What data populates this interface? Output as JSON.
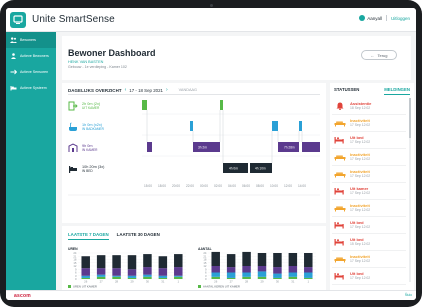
{
  "app": {
    "title": "Unite SmartSense"
  },
  "topbar": {
    "user": "Aanyall",
    "logout": "Uitloggen"
  },
  "sidebar": {
    "items": [
      {
        "label": "Bewoners",
        "icon": "users-icon"
      },
      {
        "label": "Actieve Bewoners",
        "icon": "person-icon"
      },
      {
        "label": "Actieve Sensoren",
        "icon": "sensor-icon"
      },
      {
        "label": "Actieve Systeem",
        "icon": "bed-icon"
      }
    ]
  },
  "header": {
    "title": "Bewoner Dashboard",
    "resident_name": "HENK VAN BASTEN",
    "resident_location": "Gebouw - 1e verdieping - Kamer 102",
    "back_label": "Terug"
  },
  "daily": {
    "title": "DAGELIJKS OVERZICHT",
    "date_range": "17 - 18 Sep 2021",
    "today_label": "VANDAAG",
    "activities": [
      {
        "duration": "2h 0m (2x)",
        "label": "UIT KAMER",
        "color": "#57b947",
        "icon": "door-exit-icon"
      },
      {
        "duration": "1h 0m (x2x)",
        "label": "IN BADKAMER",
        "color": "#2aa0d6",
        "icon": "bath-icon"
      },
      {
        "duration": "9h 0m",
        "label": "IN KAMER",
        "color": "#5b3a8e",
        "icon": "room-icon"
      },
      {
        "duration": "10h 20m (3x)",
        "label": "IN BED",
        "color": "#1f2a33",
        "icon": "bed-icon"
      }
    ],
    "bar_labels": {
      "kamer_1": "3h 2m",
      "kamer_2": "7h 28m",
      "bed_1": "4h 0m",
      "bed_2": "4h 10m"
    },
    "time_ticks": [
      "15:00",
      "18:00",
      "20:00",
      "22:00",
      "00:00",
      "02:00",
      "04:00",
      "06:00",
      "08:00",
      "10:00",
      "12:00",
      "14:00"
    ]
  },
  "weekly": {
    "tabs": [
      "LAATSTE 7 DAGEN",
      "LAATSTE 30 DAGEN"
    ],
    "chart_left": {
      "title": "UREN",
      "legend": "UREN UIT KAMER"
    },
    "chart_right": {
      "title": "AANTAL",
      "legend": "AANTAL KEREN UIT KAMER"
    }
  },
  "chart_data": [
    {
      "type": "bar",
      "title": "UREN",
      "categories": [
        "26",
        "27",
        "28",
        "29",
        "30",
        "31",
        "1"
      ],
      "series": [
        {
          "name": "UREN UIT KAMER",
          "values": [
            1,
            2,
            2,
            1,
            2,
            1,
            2
          ],
          "color": "#57b947"
        },
        {
          "values": [
            2,
            2,
            1,
            2,
            2,
            2,
            1
          ],
          "color": "#2aa0d6"
        },
        {
          "values": [
            7,
            6,
            7,
            6,
            7,
            7,
            8
          ],
          "color": "#5b3a8e"
        },
        {
          "values": [
            11,
            12,
            12,
            13,
            12,
            11,
            12
          ],
          "color": "#1f2a33"
        }
      ],
      "ylim": [
        0,
        24
      ],
      "yticks": [
        0,
        3,
        6,
        9,
        12,
        15,
        18,
        21,
        24
      ]
    },
    {
      "type": "bar",
      "title": "AANTAL",
      "categories": [
        "26",
        "27",
        "28",
        "29",
        "30",
        "31",
        "1"
      ],
      "series": [
        {
          "name": "AANTAL KEREN UIT KAMER",
          "values": [
            2,
            1,
            2,
            2,
            1,
            2,
            1
          ],
          "color": "#57b947"
        },
        {
          "values": [
            4,
            5,
            4,
            5,
            4,
            4,
            5
          ],
          "color": "#2aa0d6"
        },
        {
          "values": [
            6,
            5,
            6,
            5,
            6,
            6,
            5
          ],
          "color": "#5b3a8e"
        },
        {
          "values": [
            13,
            12,
            13,
            12,
            13,
            12,
            13
          ],
          "color": "#1f2a33"
        }
      ],
      "ylim": [
        0,
        24
      ],
      "yticks": [
        0,
        3,
        6,
        9,
        12,
        15,
        18,
        21,
        24
      ]
    }
  ],
  "right_panel": {
    "tabs": [
      "STATUSSEN",
      "MELDINGEN"
    ],
    "alerts": [
      {
        "title": "Assistentie",
        "time": "18 Sep 12:02",
        "color": "#e0433a",
        "icon": "bell-icon"
      },
      {
        "title": "Inactiviteit",
        "time": "17 Sep 12:02",
        "color": "#f2a52e",
        "icon": "bed-inactive-icon"
      },
      {
        "title": "Uit bed",
        "time": "17 Sep 12:02",
        "color": "#e0433a",
        "icon": "bed-exit-icon"
      },
      {
        "title": "Inactiviteit",
        "time": "17 Sep 12:02",
        "color": "#f2a52e",
        "icon": "bed-inactive-icon"
      },
      {
        "title": "Inactiviteit",
        "time": "17 Sep 12:02",
        "color": "#f2a52e",
        "icon": "bed-inactive-icon"
      },
      {
        "title": "Uit kamer",
        "time": "17 Sep 12:02",
        "color": "#e0433a",
        "icon": "bed-exit-icon"
      },
      {
        "title": "Inactiviteit",
        "time": "17 Sep 12:02",
        "color": "#f2a52e",
        "icon": "bed-inactive-icon"
      },
      {
        "title": "Uit bed",
        "time": "17 Sep 12:02",
        "color": "#e0433a",
        "icon": "bed-exit-icon"
      },
      {
        "title": "Uit bed",
        "time": "15 Sep 12:02",
        "color": "#e0433a",
        "icon": "bed-exit-icon"
      },
      {
        "title": "Inactiviteit",
        "time": "17 Sep 12:02",
        "color": "#f2a52e",
        "icon": "bed-inactive-icon"
      },
      {
        "title": "Uit bed",
        "time": "17 Sep 12:02",
        "color": "#e0433a",
        "icon": "bed-exit-icon"
      }
    ]
  },
  "footer": {
    "brand": "ascom",
    "version": "Ñuio"
  },
  "colors": {
    "accent": "#19a7a0",
    "alert_red": "#e0433a",
    "alert_orange": "#f2a52e"
  }
}
